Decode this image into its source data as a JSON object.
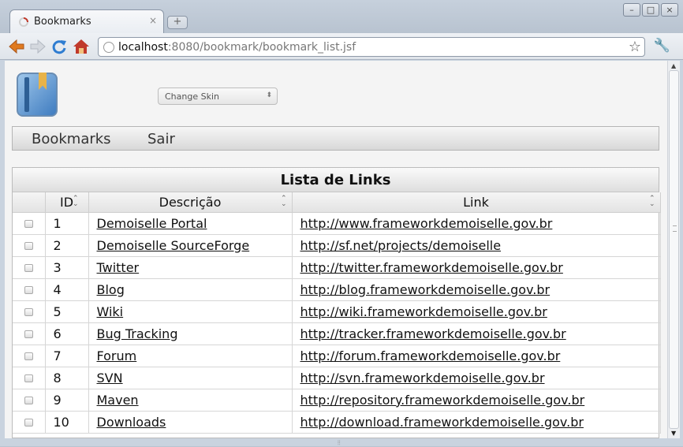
{
  "browser": {
    "tab_title": "Bookmarks",
    "tab_close": "×",
    "new_tab": "+",
    "url_host": "localhost",
    "url_rest": ":8080/bookmark/bookmark_list.jsf",
    "window_buttons": [
      "–",
      "□",
      "×"
    ]
  },
  "page": {
    "skin_label": "Change Skin",
    "menu": [
      "Bookmarks",
      "Sair"
    ],
    "panel_title": "Lista de Links",
    "columns": [
      "",
      "ID",
      "Descrição",
      "Link"
    ],
    "rows": [
      {
        "id": "1",
        "descricao": "Demoiselle Portal",
        "link": "http://www.frameworkdemoiselle.gov.br"
      },
      {
        "id": "2",
        "descricao": "Demoiselle SourceForge",
        "link": "http://sf.net/projects/demoiselle"
      },
      {
        "id": "3",
        "descricao": "Twitter",
        "link": "http://twitter.frameworkdemoiselle.gov.br"
      },
      {
        "id": "4",
        "descricao": "Blog",
        "link": "http://blog.frameworkdemoiselle.gov.br"
      },
      {
        "id": "5",
        "descricao": "Wiki",
        "link": "http://wiki.frameworkdemoiselle.gov.br"
      },
      {
        "id": "6",
        "descricao": "Bug Tracking",
        "link": "http://tracker.frameworkdemoiselle.gov.br"
      },
      {
        "id": "7",
        "descricao": "Forum",
        "link": "http://forum.frameworkdemoiselle.gov.br"
      },
      {
        "id": "8",
        "descricao": "SVN",
        "link": "http://svn.frameworkdemoiselle.gov.br"
      },
      {
        "id": "9",
        "descricao": "Maven",
        "link": "http://repository.frameworkdemoiselle.gov.br"
      },
      {
        "id": "10",
        "descricao": "Downloads",
        "link": "http://download.frameworkdemoiselle.gov.br"
      }
    ]
  },
  "colors": {
    "accent_back": "#e07a1f",
    "reload": "#2f7dd1",
    "home": "#c0392b"
  }
}
